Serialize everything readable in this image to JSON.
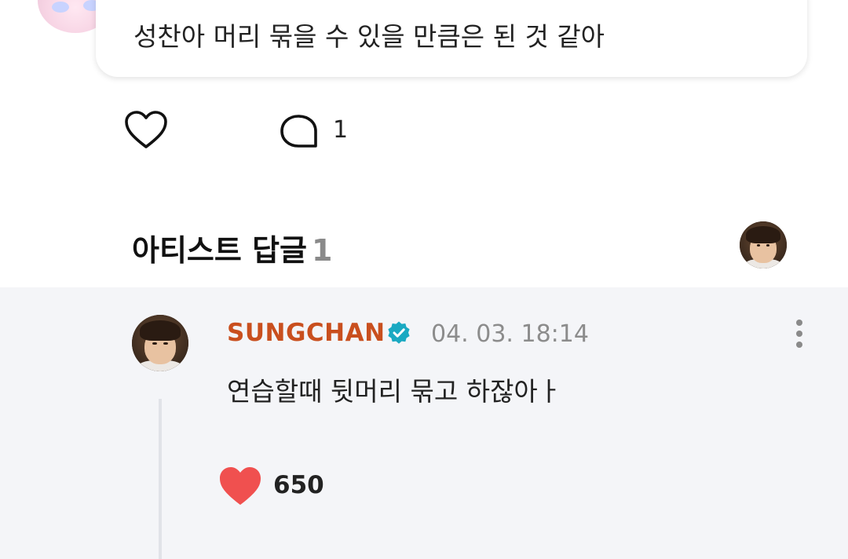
{
  "post": {
    "comment_text": "성찬아 머리 묶을 수 있을 만큼은 된 것 같아",
    "comment_count": "1"
  },
  "artist_replies": {
    "title": "아티스트 답글",
    "count": "1"
  },
  "reply": {
    "author": "SUNGCHAN",
    "timestamp": "04. 03. 18:14",
    "text": "연습할때 뒷머리 묶고 하잖아ㅏ",
    "like_count": "650"
  },
  "icons": {
    "like": "heart-outline-icon",
    "comment": "comment-bubble-icon",
    "verified": "verified-badge-icon",
    "more": "more-vertical-icon",
    "liked": "heart-filled-icon"
  },
  "colors": {
    "author": "#c94f1e",
    "verified": "#1aa9c2",
    "liked_heart": "#f0504f",
    "reply_panel_bg": "#f4f5f8"
  }
}
